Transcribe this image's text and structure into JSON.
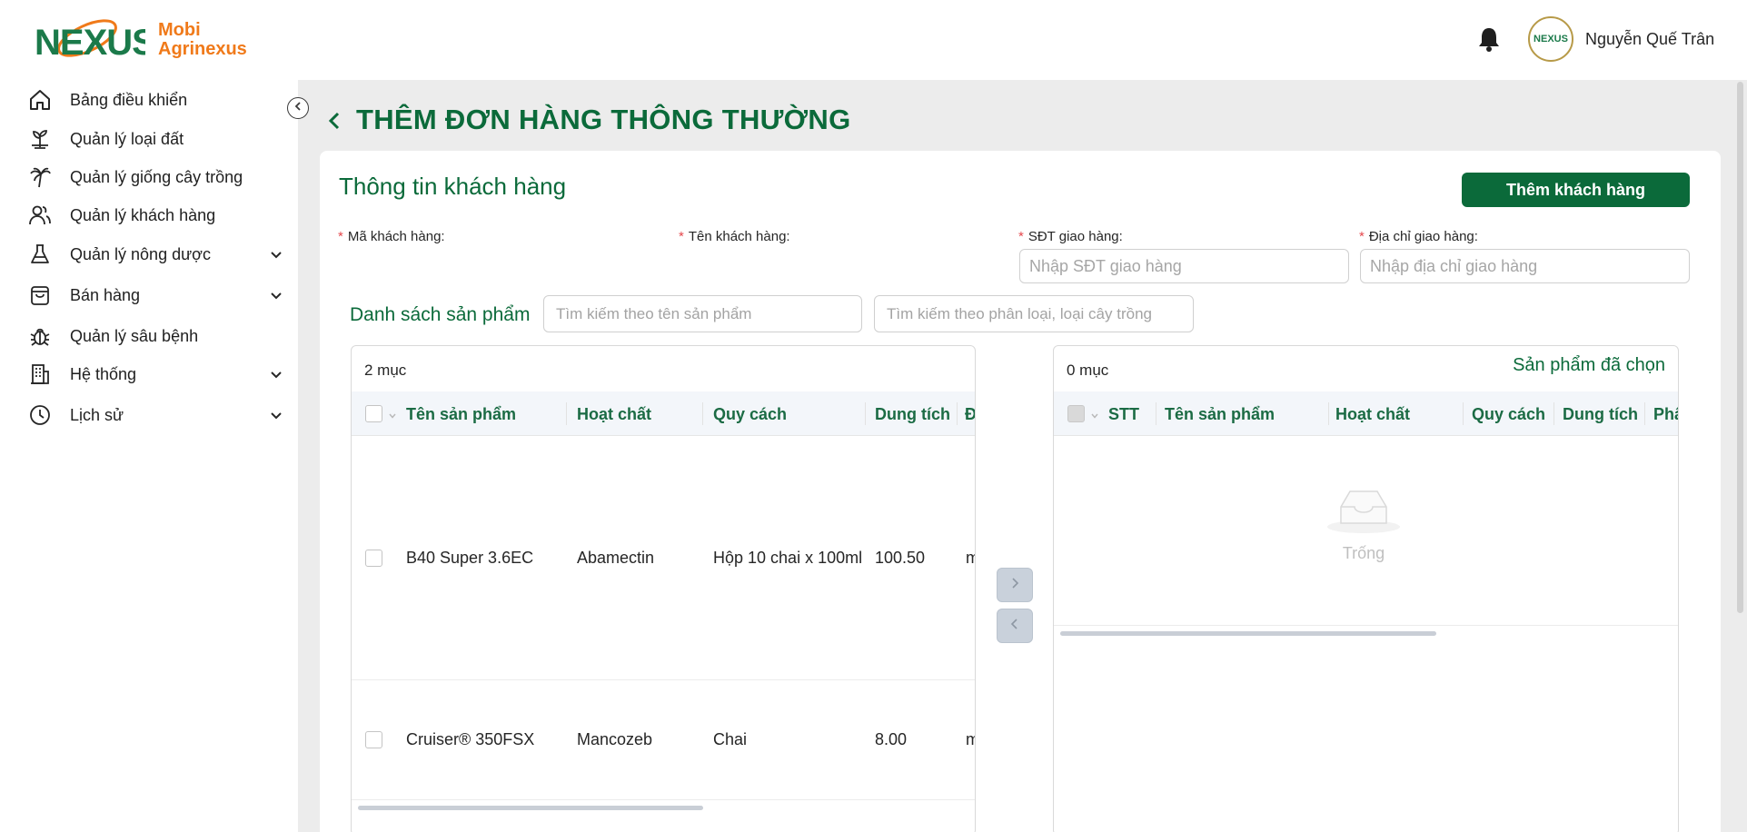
{
  "brand": {
    "logo_word": "NEXUS",
    "name_line1": "Mobi",
    "name_line2": "Agrinexus"
  },
  "user": {
    "name": "Nguyễn Quế Trân",
    "avatar_text": "NEXUS"
  },
  "sidebar": {
    "items": [
      {
        "label": "Bảng điều khiển",
        "icon": "home-icon",
        "has_submenu": false
      },
      {
        "label": "Quản lý loại đất",
        "icon": "soil-plant-icon",
        "has_submenu": false
      },
      {
        "label": "Quản lý giống cây trồng",
        "icon": "palm-tree-icon",
        "has_submenu": false
      },
      {
        "label": "Quản lý khách hàng",
        "icon": "users-icon",
        "has_submenu": false
      },
      {
        "label": "Quản lý nông dược",
        "icon": "flask-icon",
        "has_submenu": true
      },
      {
        "label": "Bán hàng",
        "icon": "shopping-bag-icon",
        "has_submenu": true
      },
      {
        "label": "Quản lý sâu bệnh",
        "icon": "bug-icon",
        "has_submenu": false
      },
      {
        "label": "Hệ thống",
        "icon": "building-icon",
        "has_submenu": true
      },
      {
        "label": "Lịch sử",
        "icon": "clock-icon",
        "has_submenu": true
      }
    ]
  },
  "page": {
    "title": "THÊM ĐƠN HÀNG THÔNG THƯỜNG"
  },
  "customer": {
    "section_title": "Thông tin khách hàng",
    "add_button": "Thêm khách hàng",
    "fields": {
      "code_label": "Mã khách hàng:",
      "name_label": "Tên khách hàng:",
      "phone_label": "SĐT giao hàng:",
      "phone_placeholder": "Nhập SĐT giao hàng",
      "address_label": "Địa chỉ giao hàng:",
      "address_placeholder": "Nhập địa chỉ giao hàng"
    }
  },
  "products": {
    "list_title": "Danh sách sản phẩm",
    "search_name_placeholder": "Tìm kiếm theo tên sản phẩm",
    "search_category_placeholder": "Tìm kiếm theo phân loại, loại cây trồng",
    "left": {
      "count": "2 mục",
      "columns": [
        "Tên sản phẩm",
        "Hoạt chất",
        "Quy cách",
        "Dung tích",
        "Đ"
      ],
      "rows": [
        {
          "name": "B40 Super 3.6EC",
          "active": "Abamectin",
          "spec": "Hộp 10 chai x 100ml",
          "volume": "100.50",
          "unit": "m"
        },
        {
          "name": "Cruiser® 350FSX",
          "active": "Mancozeb",
          "spec": "Chai",
          "volume": "8.00",
          "unit": "m"
        }
      ]
    },
    "right": {
      "count": "0 mục",
      "title": "Sản phẩm đã chọn",
      "columns": [
        "STT",
        "Tên sản phẩm",
        "Hoạt chất",
        "Quy cách",
        "Dung tích",
        "Phâ"
      ],
      "empty_text": "Trống"
    }
  },
  "colors": {
    "primary": "#0b6a3a",
    "accent": "#f07a1a",
    "content_bg": "#ececec"
  }
}
